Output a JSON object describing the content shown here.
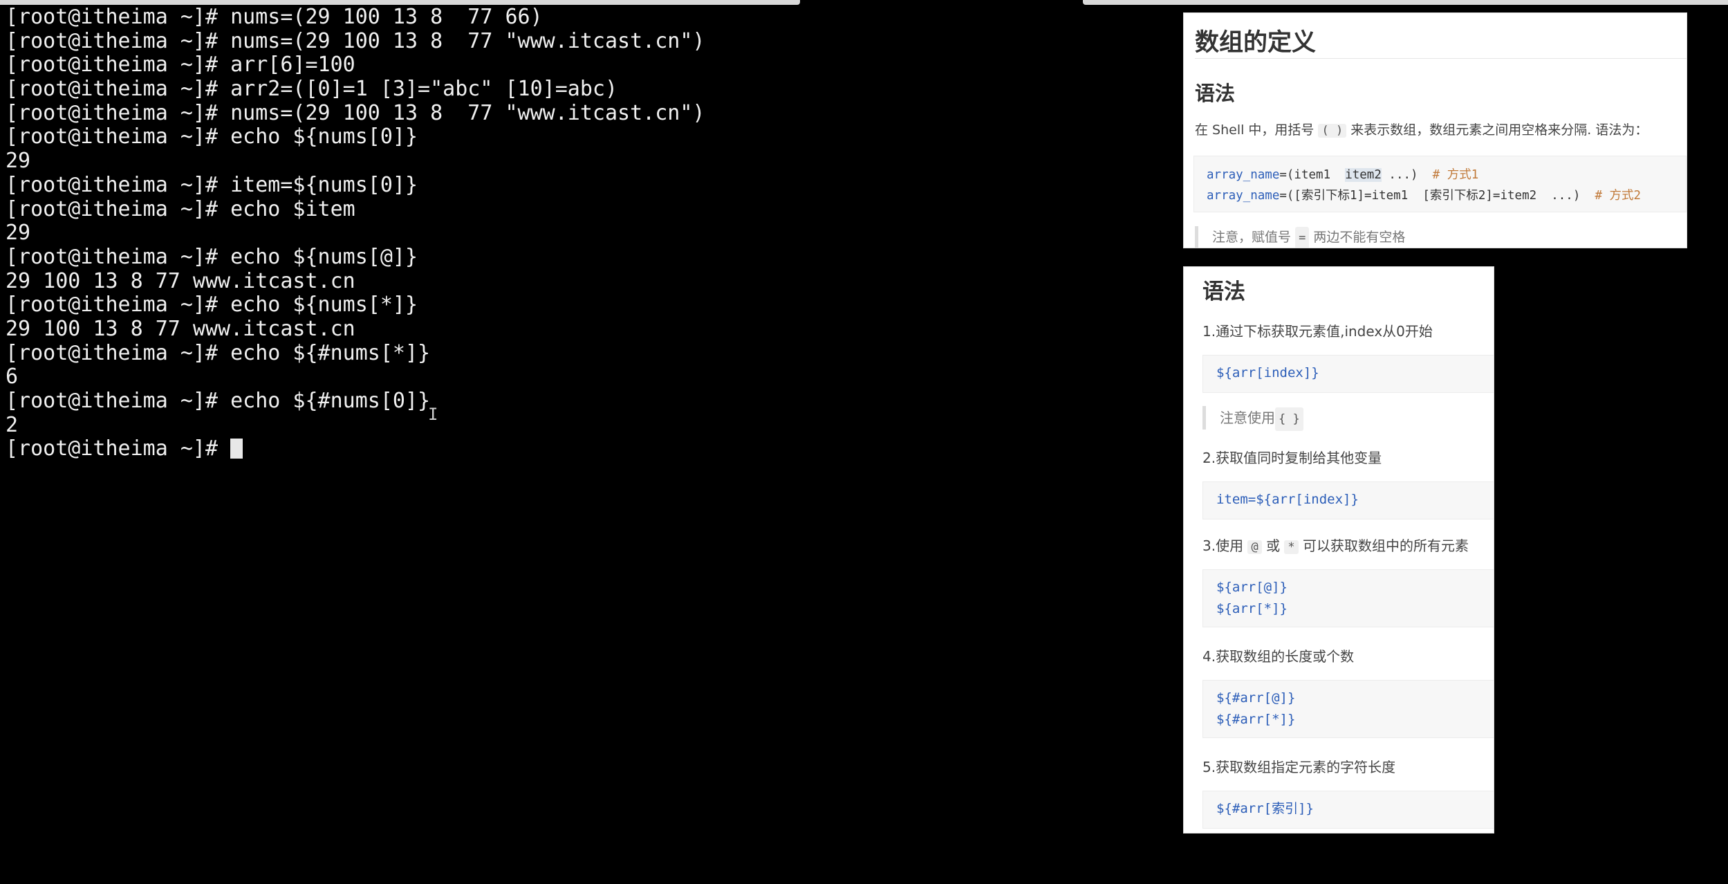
{
  "terminal": {
    "lines": [
      "[root@itheima ~]# nums=(29 100 13 8  77 66)",
      "[root@itheima ~]# nums=(29 100 13 8  77 \"www.itcast.cn\")",
      "[root@itheima ~]# arr[6]=100",
      "[root@itheima ~]# arr2=([0]=1 [3]=\"abc\" [10]=abc)",
      "[root@itheima ~]# nums=(29 100 13 8  77 \"www.itcast.cn\")",
      "[root@itheima ~]# echo ${nums[0]}",
      "29",
      "[root@itheima ~]# item=${nums[0]}",
      "[root@itheima ~]# echo $item",
      "29",
      "[root@itheima ~]# echo ${nums[@]}",
      "29 100 13 8 77 www.itcast.cn",
      "[root@itheima ~]# echo ${nums[*]}",
      "29 100 13 8 77 www.itcast.cn",
      "[root@itheima ~]# echo ${#nums[*]}",
      "6",
      "[root@itheima ~]# echo ${#nums[0]}",
      "2"
    ],
    "prompt": "[root@itheima ~]# "
  },
  "panel1": {
    "title": "数组的定义",
    "heading": "语法",
    "para_before": "在 Shell 中，用括号",
    "para_code": "( )",
    "para_after": "来表示数组，数组元素之间用空格来分隔. 语法为：",
    "code_line1": {
      "kw": "array_name",
      "eq": "=(item1  ",
      "hl": "item2",
      "rest": " ...)  ",
      "comment": "# 方式1"
    },
    "code_line2": {
      "kw": "array_name",
      "rest": "=([索引下标1]=item1  [索引下标2]=item2  ...)  ",
      "comment": "# 方式2"
    },
    "note_before": "注意，赋值号",
    "note_code": "=",
    "note_after": "两边不能有空格"
  },
  "panel2": {
    "title": "语法",
    "step1": "1.通过下标获取元素值,index从0开始",
    "code1": "${arr[index]}",
    "note1_before": "注意使用",
    "note1_code": "{ }",
    "step2": "2.获取值同时复制给其他变量",
    "code2": "item=${arr[index]}",
    "step3_before": "3.使用",
    "step3_code1": "@",
    "step3_mid": "或",
    "step3_code2": "*",
    "step3_after": "可以获取数组中的所有元素",
    "code3_line1": "${arr[@]}",
    "code3_line2": "${arr[*]}",
    "step4": "4.获取数组的长度或个数",
    "code4_line1": "${#arr[@]}",
    "code4_line2": "${#arr[*]}",
    "step5": "5.获取数组指定元素的字符长度",
    "code5": "${#arr[索引]}"
  }
}
